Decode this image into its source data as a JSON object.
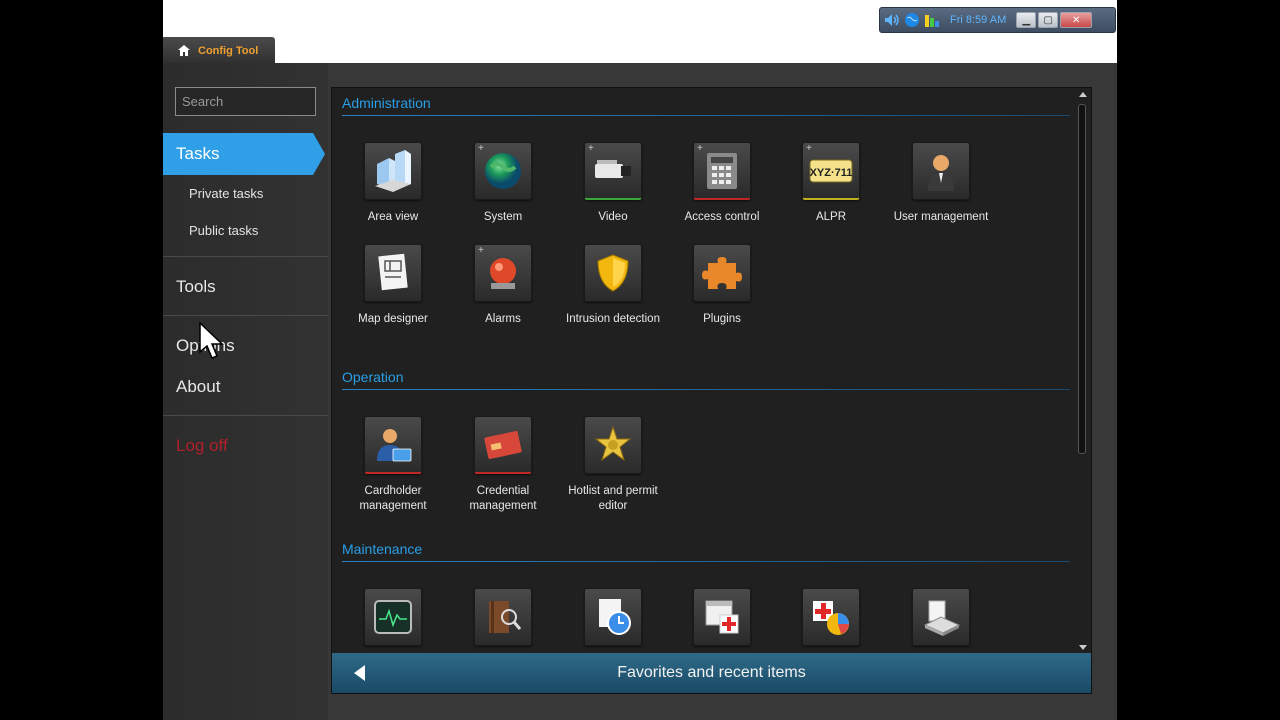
{
  "tray": {
    "time": "Fri 8:59 AM",
    "icons": [
      "speaker-icon",
      "globe-icon",
      "signal-bars-icon"
    ],
    "controls": [
      "minimize-icon",
      "maximize-icon",
      "close-icon"
    ]
  },
  "app_tab": {
    "label": "Config Tool",
    "icon": "home-icon",
    "accent": "#f0a030"
  },
  "sidebar": {
    "search_placeholder": "Search",
    "tasks": "Tasks",
    "private_tasks": "Private tasks",
    "public_tasks": "Public tasks",
    "tools": "Tools",
    "options": "Options",
    "about": "About",
    "logoff": "Log off",
    "active_color": "#2fa0e8"
  },
  "sections": {
    "administration": {
      "title": "Administration",
      "items": [
        {
          "label": "Area view",
          "icon": "buildings-icon"
        },
        {
          "label": "System",
          "icon": "globe-icon"
        },
        {
          "label": "Video",
          "icon": "camera-icon"
        },
        {
          "label": "Access control",
          "icon": "keypad-icon"
        },
        {
          "label": "ALPR",
          "icon": "license-plate-icon",
          "plate": "XYZ·711"
        },
        {
          "label": "User management",
          "icon": "user-icon"
        },
        {
          "label": "Map designer",
          "icon": "map-icon"
        },
        {
          "label": "Alarms",
          "icon": "alarm-light-icon"
        },
        {
          "label": "Intrusion detection",
          "icon": "shield-icon"
        },
        {
          "label": "Plugins",
          "icon": "puzzle-icon"
        }
      ]
    },
    "operation": {
      "title": "Operation",
      "items": [
        {
          "label": "Cardholder management",
          "icon": "cardholder-icon"
        },
        {
          "label": "Credential management",
          "icon": "credential-card-icon"
        },
        {
          "label": "Hotlist and permit editor",
          "icon": "sheriff-badge-icon"
        }
      ]
    },
    "maintenance": {
      "title": "Maintenance",
      "items": [
        {
          "icon": "health-monitor-icon"
        },
        {
          "icon": "audit-book-icon"
        },
        {
          "icon": "scheduled-report-icon"
        },
        {
          "icon": "health-calendar-icon"
        },
        {
          "icon": "health-stats-icon"
        },
        {
          "icon": "hardware-inventory-icon"
        }
      ]
    }
  },
  "favorites": {
    "label": "Favorites and recent items"
  }
}
